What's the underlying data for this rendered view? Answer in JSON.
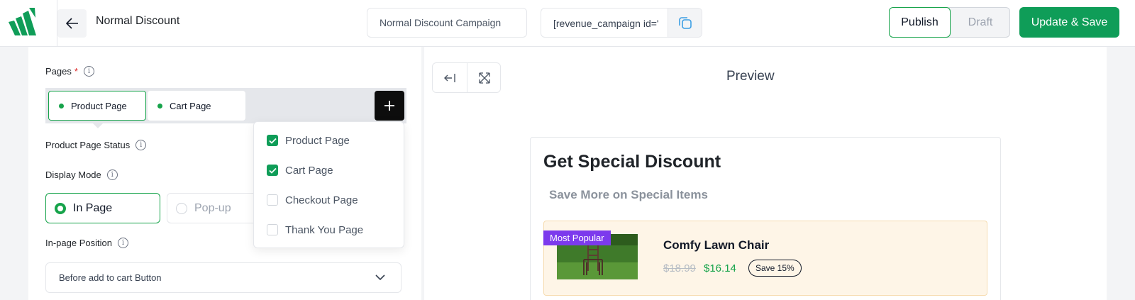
{
  "header": {
    "title": "Normal Discount",
    "campaign_name_value": "Normal Discount Campaign",
    "shortcode": "[revenue_campaign id='",
    "publish_label": "Publish",
    "draft_label": "Draft",
    "update_label": "Update & Save",
    "brand_color": "#0f9d58"
  },
  "settings": {
    "pages_label": "Pages",
    "required_mark": "*",
    "page_chips": [
      "Product Page",
      "Cart Page"
    ],
    "product_page_status_label": "Product Page Status",
    "display_mode_label": "Display Mode",
    "display_modes": [
      "In Page",
      "Pop-up"
    ],
    "selected_display_mode": "In Page",
    "inpage_position_label": "In-page Position",
    "inpage_position_value": "Before add to cart Button"
  },
  "pages_dropdown": {
    "items": [
      {
        "label": "Product Page",
        "checked": true
      },
      {
        "label": "Cart Page",
        "checked": true
      },
      {
        "label": "Checkout Page",
        "checked": false
      },
      {
        "label": "Thank You Page",
        "checked": false
      }
    ]
  },
  "preview": {
    "title": "Preview",
    "heading": "Get Special Discount",
    "subheading": "Save More on Special Items",
    "product": {
      "badge": "Most Popular",
      "name": "Comfy Lawn Chair",
      "old_price": "$18.99",
      "new_price": "$16.14",
      "save_badge": "Save 15%"
    }
  }
}
